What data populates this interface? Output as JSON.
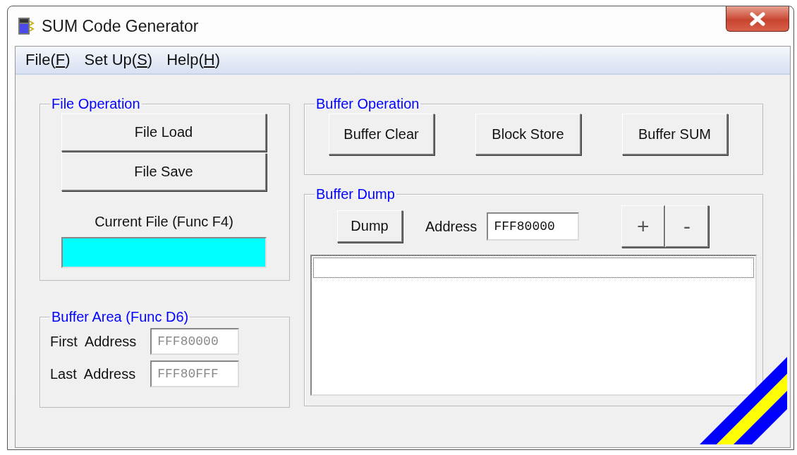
{
  "window": {
    "title": "SUM Code Generator"
  },
  "menu": [
    {
      "before": "File(",
      "key": "F",
      "after": ")"
    },
    {
      "before": "Set Up(",
      "key": "S",
      "after": ")"
    },
    {
      "before": "Help(",
      "key": "H",
      "after": ")"
    }
  ],
  "file_operation": {
    "title": "File Operation",
    "buttons": [
      "File Load",
      "File Save"
    ],
    "current_file_label": "Current File (Func F4)"
  },
  "buffer_area": {
    "title": "Buffer Area (Func D6)",
    "fields": [
      {
        "label": "First  Address",
        "value": "FFF80000",
        "disabled": true
      },
      {
        "label": "Last  Address",
        "value": "FFF80FFF",
        "disabled": true
      }
    ]
  },
  "buffer_operation": {
    "title": "Buffer Operation",
    "buttons": [
      "Buffer Clear",
      "Block Store",
      "Buffer SUM"
    ]
  },
  "buffer_dump": {
    "title": "Buffer Dump",
    "dump_button": "Dump",
    "address_label": "Address",
    "address_value": "FFF80000",
    "step_buttons": [
      "+",
      "-"
    ]
  }
}
